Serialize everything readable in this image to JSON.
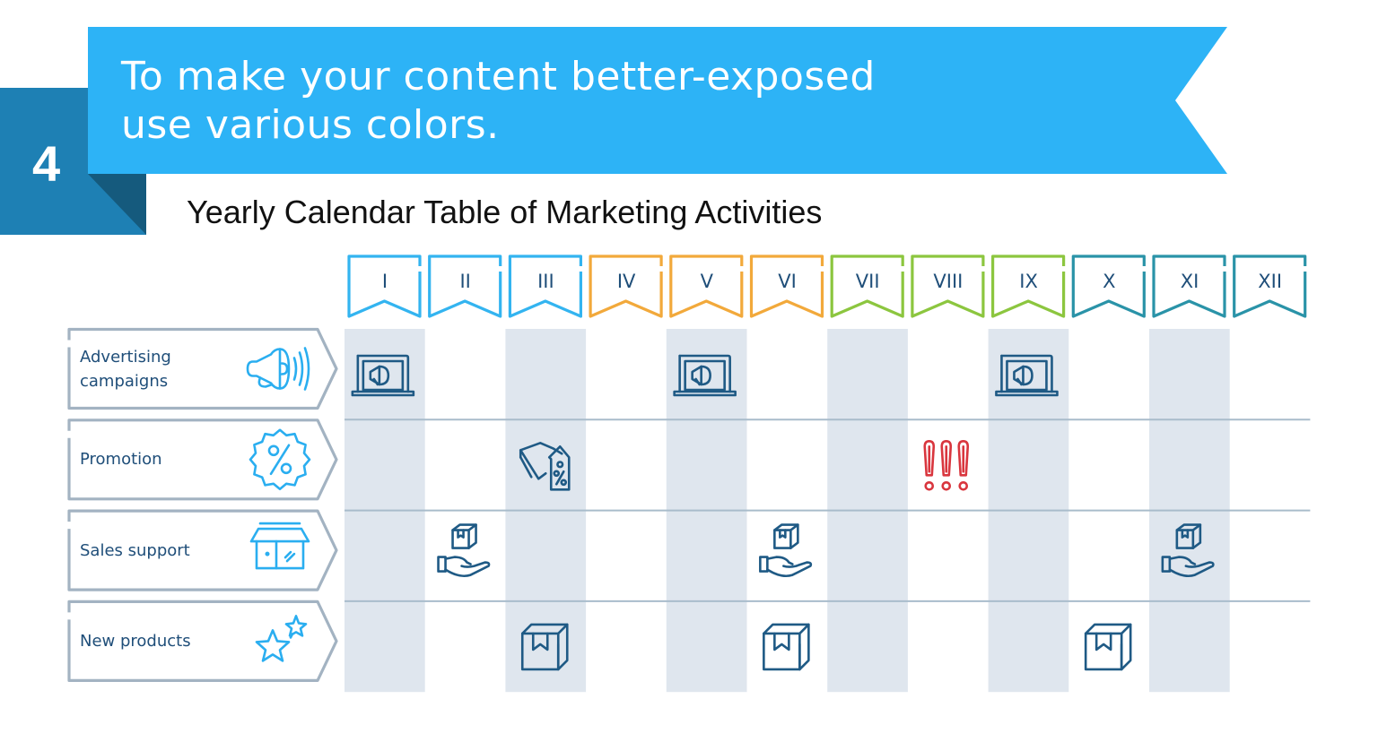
{
  "banner": {
    "step_number": "4",
    "headline_line1": "To make your content better-exposed",
    "headline_line2": "use various colors.",
    "colors": {
      "banner": "#2db3f6",
      "square": "#1e80b4",
      "fold": "#155a7d"
    }
  },
  "subtitle": "Yearly Calendar Table of Marketing Activities",
  "months": [
    {
      "label": "I",
      "color": "#33b4f0"
    },
    {
      "label": "II",
      "color": "#33b4f0"
    },
    {
      "label": "III",
      "color": "#33b4f0"
    },
    {
      "label": "IV",
      "color": "#f2a93b"
    },
    {
      "label": "V",
      "color": "#f2a93b"
    },
    {
      "label": "VI",
      "color": "#f2a93b"
    },
    {
      "label": "VII",
      "color": "#8cc63f"
    },
    {
      "label": "VIII",
      "color": "#8cc63f"
    },
    {
      "label": "IX",
      "color": "#8cc63f"
    },
    {
      "label": "X",
      "color": "#2a93a8"
    },
    {
      "label": "XI",
      "color": "#2a93a8"
    },
    {
      "label": "XII",
      "color": "#2a93a8"
    }
  ],
  "rows": [
    {
      "label_lines": [
        "Advertising",
        "campaigns"
      ],
      "icon": "megaphone-icon"
    },
    {
      "label_lines": [
        "Promotion"
      ],
      "icon": "percent-badge-icon"
    },
    {
      "label_lines": [
        "Sales support"
      ],
      "icon": "storefront-icon"
    },
    {
      "label_lines": [
        "New products"
      ],
      "icon": "stars-icon"
    }
  ],
  "activities": [
    {
      "row": 0,
      "month": 0,
      "icon": "laptop-megaphone-icon"
    },
    {
      "row": 0,
      "month": 4,
      "icon": "laptop-megaphone-icon"
    },
    {
      "row": 0,
      "month": 8,
      "icon": "laptop-megaphone-icon"
    },
    {
      "row": 1,
      "month": 2,
      "icon": "price-tags-percent-icon"
    },
    {
      "row": 1,
      "month": 7,
      "icon": "exclamation-marks-icon"
    },
    {
      "row": 2,
      "month": 1,
      "icon": "hand-box-icon"
    },
    {
      "row": 2,
      "month": 5,
      "icon": "hand-box-icon"
    },
    {
      "row": 2,
      "month": 10,
      "icon": "hand-box-icon"
    },
    {
      "row": 3,
      "month": 2,
      "icon": "box-icon"
    },
    {
      "row": 3,
      "month": 5,
      "icon": "box-icon"
    },
    {
      "row": 3,
      "month": 9,
      "icon": "box-icon"
    }
  ],
  "colors": {
    "icon_dark": "#1f5a85",
    "icon_light": "#2aaef0",
    "alert": "#d9363e",
    "column_shade": "#dfe6ee",
    "row_line": "#a9bccb",
    "label_border": "#a3b3c2"
  }
}
